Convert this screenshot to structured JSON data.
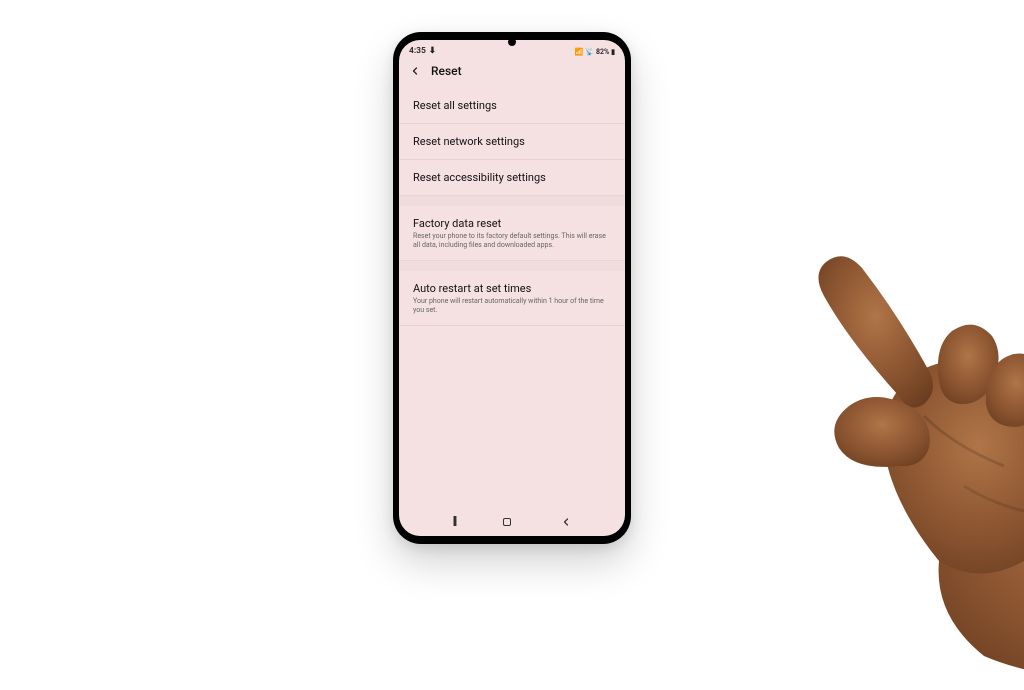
{
  "status": {
    "time": "4:35",
    "signal": "⚡",
    "wifi": "📶",
    "volte": "📡",
    "battery_pct": "82%",
    "battery_icon": "■"
  },
  "header": {
    "back": "‹",
    "title": "Reset"
  },
  "items": {
    "reset_all": {
      "title": "Reset all settings"
    },
    "reset_network": {
      "title": "Reset network settings"
    },
    "reset_accessibility": {
      "title": "Reset accessibility settings"
    },
    "factory_reset": {
      "title": "Factory data reset",
      "sub": "Reset your phone to its factory default settings. This will erase all data, including files and downloaded apps."
    },
    "auto_restart": {
      "title": "Auto restart at set times",
      "sub": "Your phone will restart automatically within 1 hour of the time you set."
    }
  },
  "nav": {
    "recents": "III",
    "home": "◯",
    "back": "‹"
  }
}
